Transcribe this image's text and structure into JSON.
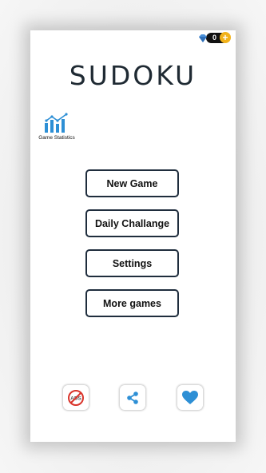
{
  "app": {
    "title": "SUDOKU"
  },
  "coins": {
    "count": "0",
    "plus": "+"
  },
  "stats": {
    "label": "Game Statistics"
  },
  "menu": {
    "new_game": "New Game",
    "daily": "Daily Challange",
    "settings": "Settings",
    "more": "More games"
  },
  "icons": {
    "no_ads": "no-ads-icon",
    "share": "share-icon",
    "rate": "heart-icon"
  },
  "no_ads_text": "ADS",
  "colors": {
    "accent": "#2d8fd5",
    "border": "#1f2d3d",
    "gold": "#f2b21a"
  }
}
